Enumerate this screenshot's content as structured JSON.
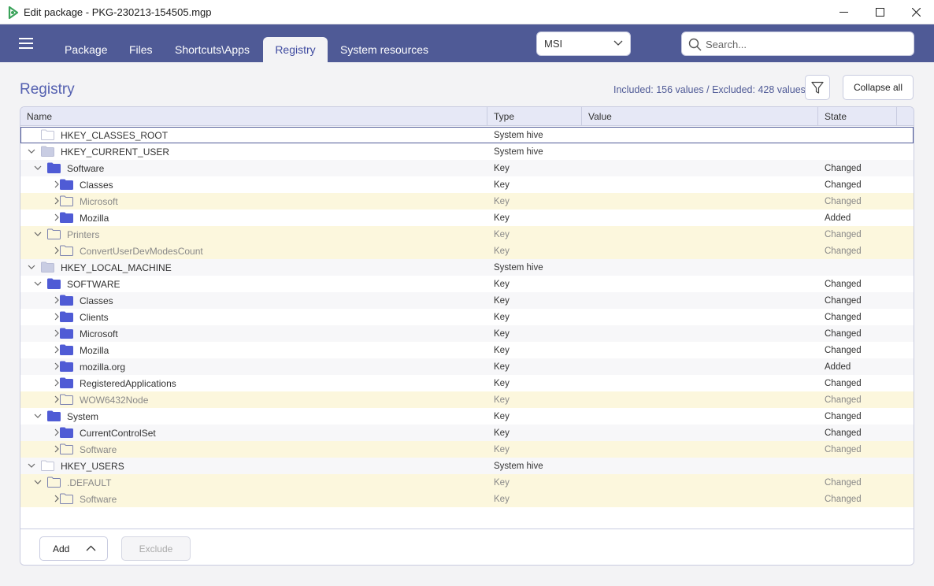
{
  "window": {
    "title": "Edit package - PKG-230213-154505.mgp",
    "minimize_icon": "minimize-icon",
    "maximize_icon": "maximize-icon",
    "close_icon": "close-icon"
  },
  "nav": {
    "menu_icon": "hamburger-menu-icon",
    "tabs": [
      {
        "label": "Package"
      },
      {
        "label": "Files"
      },
      {
        "label": "Shortcuts\\Apps"
      },
      {
        "label": "Registry",
        "active": true
      },
      {
        "label": "System resources"
      }
    ],
    "format_select": {
      "value": "MSI"
    },
    "search": {
      "placeholder": "Search..."
    }
  },
  "registry": {
    "title": "Registry",
    "summary": "Included: 156 values / Excluded: 428 values",
    "collapse_all_label": "Collapse all",
    "columns": {
      "name": "Name",
      "type": "Type",
      "value": "Value",
      "state": "State"
    },
    "rows": [
      {
        "name": "HKEY_CLASSES_ROOT",
        "type": "System hive",
        "state": "",
        "level": 0,
        "expand": "none",
        "folder": "hive-empty",
        "style": "selected"
      },
      {
        "name": "HKEY_CURRENT_USER",
        "type": "System hive",
        "state": "",
        "level": 0,
        "expand": "open",
        "folder": "hive",
        "style": ""
      },
      {
        "name": "Software",
        "type": "Key",
        "state": "Changed",
        "level": 1,
        "expand": "open",
        "folder": "filled",
        "style": "alt"
      },
      {
        "name": "Classes",
        "type": "Key",
        "state": "Changed",
        "level": 2,
        "expand": "closed",
        "folder": "filled",
        "style": ""
      },
      {
        "name": "Microsoft",
        "type": "Key",
        "state": "Changed",
        "level": 2,
        "expand": "closed",
        "folder": "outline",
        "style": "excluded"
      },
      {
        "name": "Mozilla",
        "type": "Key",
        "state": "Added",
        "level": 2,
        "expand": "closed",
        "folder": "filled",
        "style": ""
      },
      {
        "name": "Printers",
        "type": "Key",
        "state": "Changed",
        "level": 1,
        "expand": "open",
        "folder": "outline",
        "style": "excluded"
      },
      {
        "name": "ConvertUserDevModesCount",
        "type": "Key",
        "state": "Changed",
        "level": 2,
        "expand": "closed",
        "folder": "outline",
        "style": "excluded"
      },
      {
        "name": "HKEY_LOCAL_MACHINE",
        "type": "System hive",
        "state": "",
        "level": 0,
        "expand": "open",
        "folder": "hive",
        "style": "alt"
      },
      {
        "name": "SOFTWARE",
        "type": "Key",
        "state": "Changed",
        "level": 1,
        "expand": "open",
        "folder": "filled",
        "style": ""
      },
      {
        "name": "Classes",
        "type": "Key",
        "state": "Changed",
        "level": 2,
        "expand": "closed",
        "folder": "filled",
        "style": "alt"
      },
      {
        "name": "Clients",
        "type": "Key",
        "state": "Changed",
        "level": 2,
        "expand": "closed",
        "folder": "filled",
        "style": ""
      },
      {
        "name": "Microsoft",
        "type": "Key",
        "state": "Changed",
        "level": 2,
        "expand": "closed",
        "folder": "filled",
        "style": "alt"
      },
      {
        "name": "Mozilla",
        "type": "Key",
        "state": "Changed",
        "level": 2,
        "expand": "closed",
        "folder": "filled",
        "style": ""
      },
      {
        "name": "mozilla.org",
        "type": "Key",
        "state": "Added",
        "level": 2,
        "expand": "closed",
        "folder": "filled",
        "style": "alt"
      },
      {
        "name": "RegisteredApplications",
        "type": "Key",
        "state": "Changed",
        "level": 2,
        "expand": "closed",
        "folder": "filled",
        "style": ""
      },
      {
        "name": "WOW6432Node",
        "type": "Key",
        "state": "Changed",
        "level": 2,
        "expand": "closed",
        "folder": "outline",
        "style": "excluded"
      },
      {
        "name": "System",
        "type": "Key",
        "state": "Changed",
        "level": 1,
        "expand": "open",
        "folder": "filled",
        "style": ""
      },
      {
        "name": "CurrentControlSet",
        "type": "Key",
        "state": "Changed",
        "level": 2,
        "expand": "closed",
        "folder": "filled",
        "style": "alt"
      },
      {
        "name": "Software",
        "type": "Key",
        "state": "Changed",
        "level": 2,
        "expand": "closed",
        "folder": "outline",
        "style": "excluded"
      },
      {
        "name": "HKEY_USERS",
        "type": "System hive",
        "state": "",
        "level": 0,
        "expand": "open",
        "folder": "hive-empty",
        "style": "alt"
      },
      {
        "name": ".DEFAULT",
        "type": "Key",
        "state": "Changed",
        "level": 1,
        "expand": "open",
        "folder": "outline",
        "style": "excluded"
      },
      {
        "name": "Software",
        "type": "Key",
        "state": "Changed",
        "level": 2,
        "expand": "closed",
        "folder": "outline",
        "style": "excluded"
      }
    ],
    "footer": {
      "add_label": "Add",
      "exclude_label": "Exclude"
    }
  },
  "colors": {
    "nav_bg": "#4f5a96",
    "accent": "#5460b0",
    "excluded_row": "#fcf7dd",
    "folder": "#4f5bd5"
  }
}
